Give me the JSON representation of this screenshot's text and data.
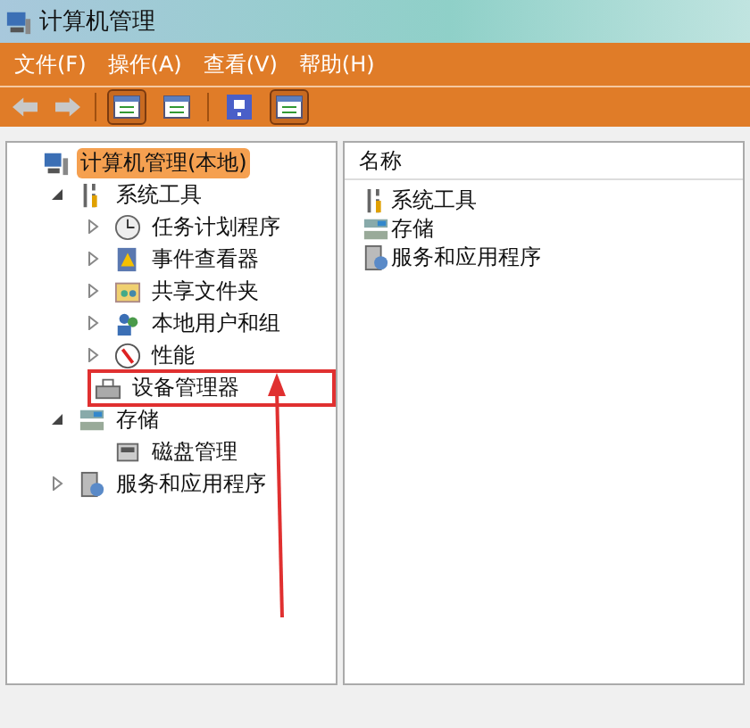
{
  "window": {
    "title": "计算机管理"
  },
  "menu": [
    {
      "label": "文件(F)"
    },
    {
      "label": "操作(A)"
    },
    {
      "label": "查看(V)"
    },
    {
      "label": "帮助(H)"
    }
  ],
  "toolbar": [
    {
      "kind": "back",
      "disabled": true
    },
    {
      "kind": "forward",
      "disabled": true
    },
    {
      "kind": "sep"
    },
    {
      "kind": "tree",
      "selected": true
    },
    {
      "kind": "props",
      "selected": false
    },
    {
      "kind": "sep"
    },
    {
      "kind": "help",
      "selected": false
    },
    {
      "kind": "panel",
      "selected": true
    }
  ],
  "tree": [
    {
      "label": "计算机管理(本地)",
      "kind": "computer",
      "selected": true,
      "children": [
        {
          "label": "系统工具",
          "kind": "tools",
          "selected": false,
          "expanded": true,
          "children": [
            {
              "label": "任务计划程序",
              "kind": "clock",
              "selected": false,
              "expanded": false
            },
            {
              "label": "事件查看器",
              "kind": "event",
              "selected": false,
              "expanded": false
            },
            {
              "label": "共享文件夹",
              "kind": "share",
              "selected": false,
              "expanded": false
            },
            {
              "label": "本地用户和组",
              "kind": "users",
              "selected": false,
              "expanded": false
            },
            {
              "label": "性能",
              "kind": "perf",
              "selected": false,
              "expanded": false
            },
            {
              "label": "设备管理器",
              "kind": "device",
              "selected": false,
              "highlighted": true
            }
          ]
        },
        {
          "label": "存储",
          "kind": "storage",
          "selected": false,
          "expanded": true,
          "children": [
            {
              "label": "磁盘管理",
              "kind": "disk",
              "selected": false
            }
          ]
        },
        {
          "label": "服务和应用程序",
          "kind": "services",
          "selected": false,
          "expanded": false
        }
      ]
    }
  ],
  "list": {
    "columns": [
      "名称"
    ],
    "rows": [
      {
        "label": "系统工具",
        "kind": "tools"
      },
      {
        "label": "存储",
        "kind": "storage"
      },
      {
        "label": "服务和应用程序",
        "kind": "services"
      }
    ]
  }
}
